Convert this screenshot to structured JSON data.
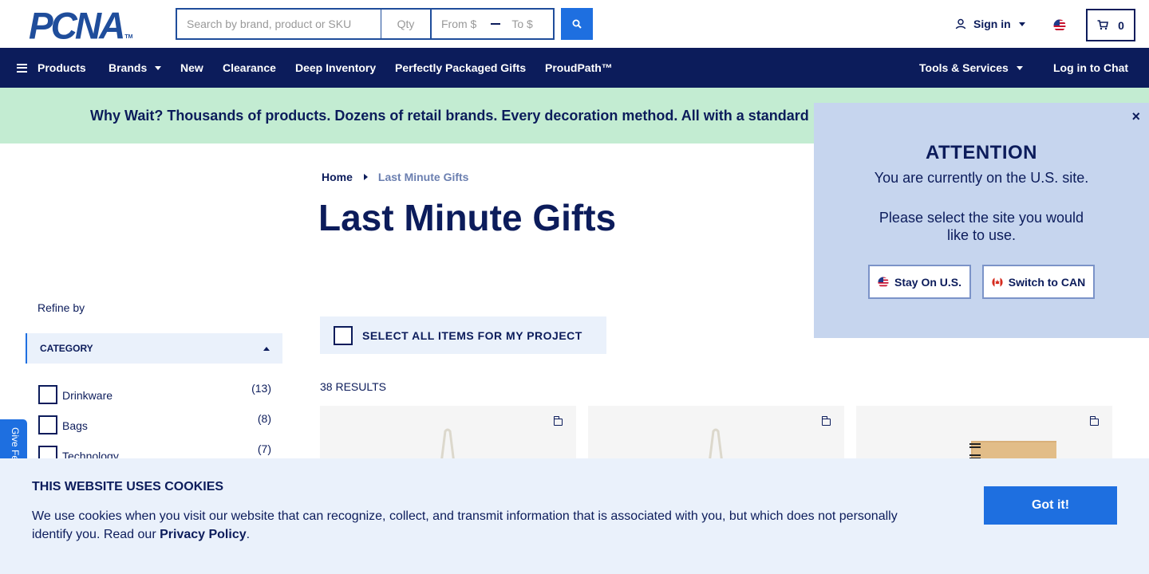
{
  "header": {
    "logo_text": "PCNA",
    "logo_tm": "TM",
    "search_placeholder": "Search by brand, product or SKU",
    "qty_placeholder": "Qty",
    "price_from_placeholder": "From $",
    "price_to_placeholder": "To $",
    "signin_label": "Sign in",
    "cart_count": "0"
  },
  "nav": {
    "items": [
      {
        "label": "Products"
      },
      {
        "label": "Brands"
      },
      {
        "label": "New"
      },
      {
        "label": "Clearance"
      },
      {
        "label": "Deep Inventory"
      },
      {
        "label": "Perfectly Packaged Gifts"
      },
      {
        "label": "ProudPath™"
      },
      {
        "label": "Tools & Services"
      },
      {
        "label": "Log in to Chat"
      }
    ]
  },
  "promo": {
    "text": "Why Wait? Thousands of products. Dozens of retail brands. Every decoration method. All with a standard"
  },
  "breadcrumb": {
    "home": "Home",
    "current": "Last Minute Gifts"
  },
  "page": {
    "title": "Last Minute Gifts"
  },
  "sidebar": {
    "refine_label": "Refine by",
    "category_header": "CATEGORY",
    "categories": [
      {
        "label": "Drinkware",
        "count": "(13)"
      },
      {
        "label": "Bags",
        "count": "(8)"
      },
      {
        "label": "Technology",
        "count": "(7)"
      }
    ],
    "feedback_label": "Give Feedback"
  },
  "results": {
    "select_all_label": "SELECT ALL ITEMS FOR MY PROJECT",
    "count_label": "38 RESULTS"
  },
  "popup": {
    "close": "×",
    "title": "ATTENTION",
    "line1": "You are currently on the U.S. site.",
    "line2": "Please select the site you would like to use.",
    "stay_label": "Stay On U.S.",
    "switch_label": "Switch to CAN"
  },
  "cookie": {
    "title": "THIS WEBSITE USES COOKIES",
    "body": "We use cookies when you visit our website that can recognize, collect, and transmit information that is associated with you, but which does not personally identify you. Read our ",
    "link": "Privacy Policy",
    "period": ".",
    "button": "Got it!"
  },
  "colors": {
    "navy": "#0c1c5b",
    "blue": "#1e6fe0",
    "promo_green": "#c3ecd2",
    "popup_bg": "#c6d5ee",
    "light_blue": "#eaf1fb"
  },
  "icons": [
    "search-icon",
    "user-icon",
    "us-flag-icon",
    "cart-icon",
    "hamburger-icon",
    "close-icon",
    "ca-flag-icon",
    "add-to-project-icon"
  ]
}
